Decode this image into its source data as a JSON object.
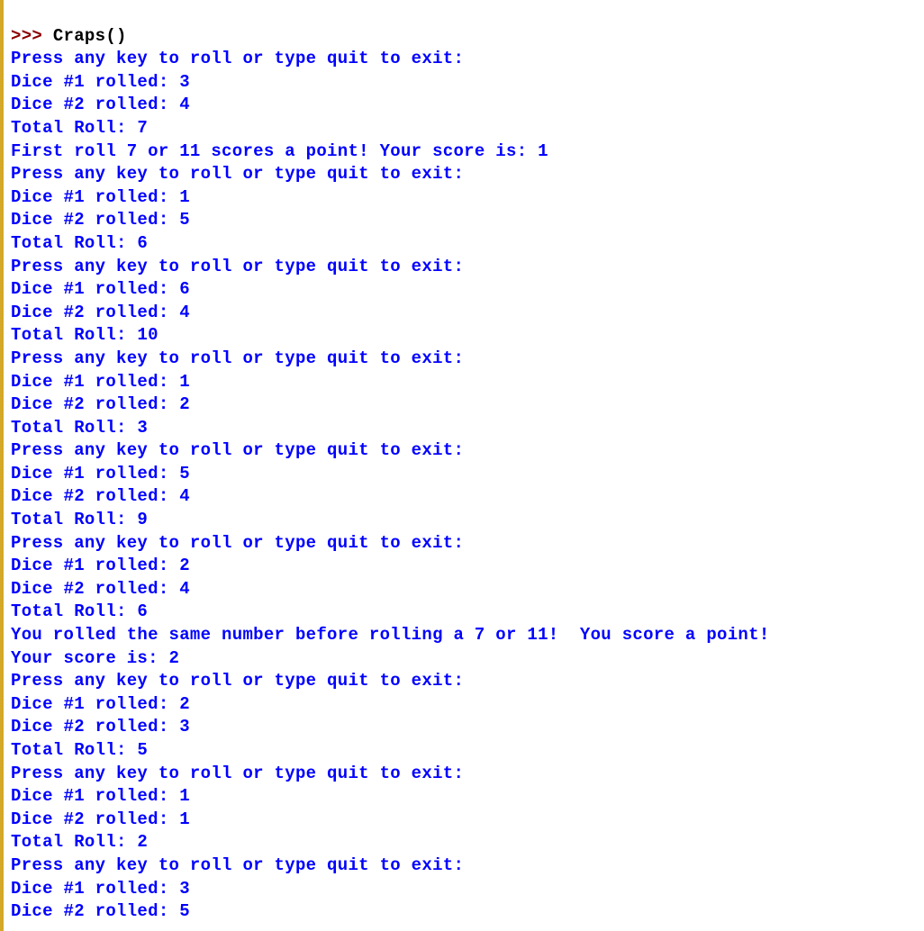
{
  "prompt_symbol": ">>> ",
  "command": "Craps()",
  "lines": [
    "Press any key to roll or type quit to exit:",
    "Dice #1 rolled: 3",
    "Dice #2 rolled: 4",
    "Total Roll: 7",
    "First roll 7 or 11 scores a point! Your score is: 1",
    "Press any key to roll or type quit to exit:",
    "Dice #1 rolled: 1",
    "Dice #2 rolled: 5",
    "Total Roll: 6",
    "Press any key to roll or type quit to exit:",
    "Dice #1 rolled: 6",
    "Dice #2 rolled: 4",
    "Total Roll: 10",
    "Press any key to roll or type quit to exit:",
    "Dice #1 rolled: 1",
    "Dice #2 rolled: 2",
    "Total Roll: 3",
    "Press any key to roll or type quit to exit:",
    "Dice #1 rolled: 5",
    "Dice #2 rolled: 4",
    "Total Roll: 9",
    "Press any key to roll or type quit to exit:",
    "Dice #1 rolled: 2",
    "Dice #2 rolled: 4",
    "Total Roll: 6",
    "You rolled the same number before rolling a 7 or 11!  You score a point!",
    "Your score is: 2",
    "Press any key to roll or type quit to exit:",
    "Dice #1 rolled: 2",
    "Dice #2 rolled: 3",
    "Total Roll: 5",
    "Press any key to roll or type quit to exit:",
    "Dice #1 rolled: 1",
    "Dice #2 rolled: 1",
    "Total Roll: 2",
    "Press any key to roll or type quit to exit:",
    "Dice #1 rolled: 3",
    "Dice #2 rolled: 5"
  ]
}
